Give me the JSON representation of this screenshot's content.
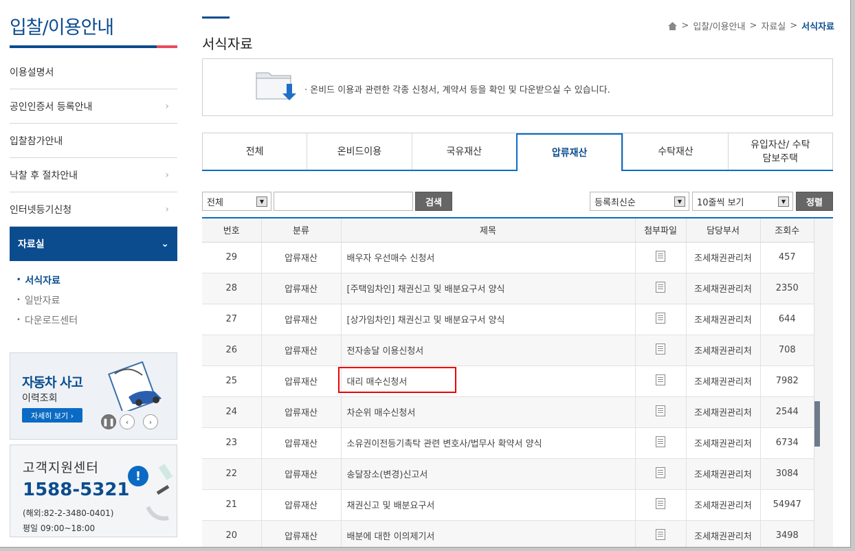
{
  "sidebar": {
    "title": "입찰/이용안내",
    "menu": [
      {
        "label": "이용설명서",
        "chevron": ""
      },
      {
        "label": "공인인증서 등록안내",
        "chevron": "›"
      },
      {
        "label": "입찰참가안내",
        "chevron": ""
      },
      {
        "label": "낙찰 후 절차안내",
        "chevron": "›"
      },
      {
        "label": "인터넷등기신청",
        "chevron": "›"
      },
      {
        "label": "자료실",
        "chevron": "⌄"
      }
    ],
    "submenu": [
      {
        "label": "서식자료"
      },
      {
        "label": "일반자료"
      },
      {
        "label": "다운로드센터"
      }
    ],
    "banner_car": {
      "title": "자동차 사고",
      "subtitle": "이력조회",
      "button": "자세히 보기 ›"
    },
    "banner_cs": {
      "title": "고객지원센터",
      "phone": "1588-5321",
      "overseas": "(해외:82-2-3480-0401)",
      "hours": "평일 09:00~18:00"
    }
  },
  "main": {
    "page_title": "서식자료",
    "breadcrumb": {
      "sep": ">",
      "items": [
        "입찰/이용안내",
        "자료실"
      ],
      "current": "서식자료"
    },
    "info": "· 온비드 이용과 관련한 각종 신청서, 계약서 등을 확인 및 다운받으실 수 있습니다.",
    "tabs": [
      "전체",
      "온비드이용",
      "국유재산",
      "압류재산",
      "수탁재산",
      "유입자산/ 수탁담보주택"
    ],
    "active_tab": 3,
    "search": {
      "category": "전체",
      "query": "",
      "search_button": "검색",
      "sort": "등록최신순",
      "page_size": "10줄씩 보기",
      "sort_button": "정렬"
    },
    "table": {
      "headers": [
        "번호",
        "분류",
        "제목",
        "첨부파일",
        "담당부서",
        "조회수"
      ],
      "rows": [
        {
          "no": "29",
          "category": "압류재산",
          "title": "배우자 우선매수 신청서",
          "dept": "조세채권관리처",
          "views": "457"
        },
        {
          "no": "28",
          "category": "압류재산",
          "title": "[주택임차인] 채권신고 및 배분요구서 양식",
          "dept": "조세채권관리처",
          "views": "2350"
        },
        {
          "no": "27",
          "category": "압류재산",
          "title": "[상가임차인] 채권신고 및 배분요구서 양식",
          "dept": "조세채권관리처",
          "views": "644"
        },
        {
          "no": "26",
          "category": "압류재산",
          "title": "전자송달 이용신청서",
          "dept": "조세채권관리처",
          "views": "708"
        },
        {
          "no": "25",
          "category": "압류재산",
          "title": "대리 매수신청서",
          "dept": "조세채권관리처",
          "views": "7982"
        },
        {
          "no": "24",
          "category": "압류재산",
          "title": "차순위 매수신청서",
          "dept": "조세채권관리처",
          "views": "2544"
        },
        {
          "no": "23",
          "category": "압류재산",
          "title": "소유권이전등기촉탁 관련 변호사/법무사 확약서 양식",
          "dept": "조세채권관리처",
          "views": "6734"
        },
        {
          "no": "22",
          "category": "압류재산",
          "title": "송달장소(변경)신고서",
          "dept": "조세채권관리처",
          "views": "3084"
        },
        {
          "no": "21",
          "category": "압류재산",
          "title": "채권신고 및 배분요구서",
          "dept": "조세채권관리처",
          "views": "54947"
        },
        {
          "no": "20",
          "category": "압류재산",
          "title": "배분에 대한 이의제기서",
          "dept": "조세채권관리처",
          "views": "3498"
        }
      ]
    }
  }
}
